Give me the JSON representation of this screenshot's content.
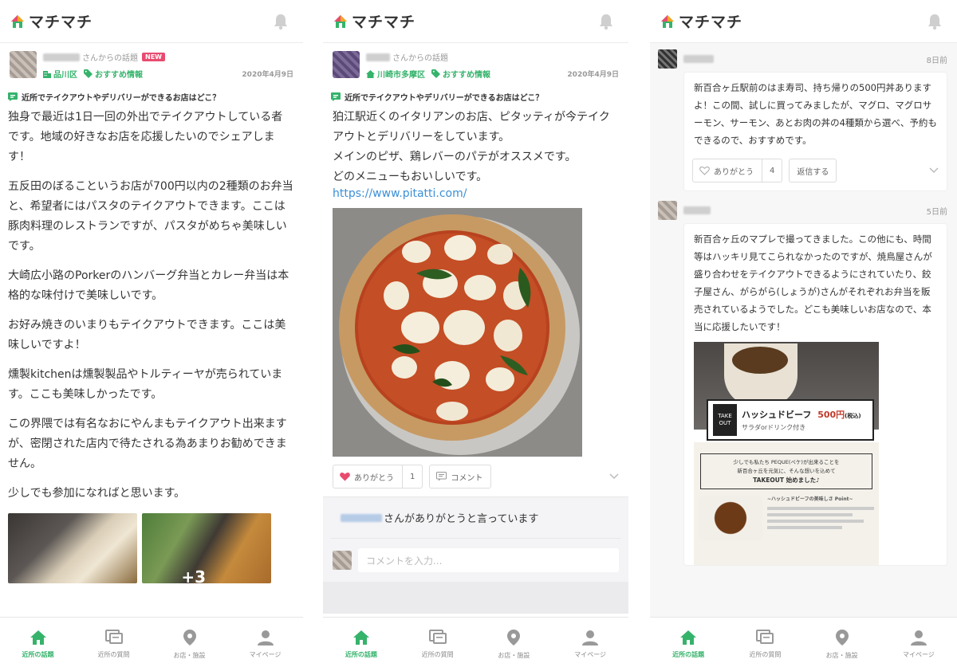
{
  "app": {
    "logo_text": "マチマチ",
    "accent": "#35b36b",
    "new_badge_color": "#e94b6f"
  },
  "tabs": [
    {
      "label": "近所の話題",
      "icon": "home-icon",
      "active": true
    },
    {
      "label": "近所の質問",
      "icon": "question-icon",
      "active": false
    },
    {
      "label": "お店・施設",
      "icon": "map-pin-icon",
      "active": false
    },
    {
      "label": "マイページ",
      "icon": "person-icon",
      "active": false
    }
  ],
  "screen1": {
    "from_suffix": "さんからの話題",
    "new_badge": "NEW",
    "area_tag": "品川区",
    "category_tag": "おすすめ情報",
    "date": "2020年4月9日",
    "topic": "近所でテイクアウトやデリバリーができるお店はどこ？",
    "paragraphs": [
      "独身で最近は1日一回の外出でテイクアウトしている者です。地域の好きなお店を応援したいのでシェアします！",
      "五反田のぼるこというお店が700円以内の2種類のお弁当と、希望者にはパスタのテイクアウトできます。ここは豚肉料理のレストランですが、パスタがめちゃ美味しいです。",
      "大崎広小路のPorkerのハンバーグ弁当とカレー弁当は本格的な味付けで美味しいです。",
      "お好み焼きのいまりもテイクアウトできます。ここは美味しいですよ！",
      "燻製kitchenは燻製製品やトルティーヤが売られています。ここも美味しかったです。",
      "この界隈では有名なおにやんまもテイクアウト出来ますが、密閉された店内で待たされる為あまりお勧めできません。",
      "少しでも参加になればと思います。"
    ],
    "more_photos": "+3"
  },
  "screen2": {
    "from_suffix": "さんからの話題",
    "area_tag": "川崎市多摩区",
    "category_tag": "おすすめ情報",
    "date": "2020年4月9日",
    "topic": "近所でテイクアウトやデリバリーができるお店はどこ？",
    "paragraphs": [
      "狛江駅近くのイタリアンのお店、ピタッティが今テイクアウトとデリバリーをしています。",
      "メインのピザ、鶏レバーのパテがオススメです。",
      "どのメニューもおいしいです。"
    ],
    "link": "https://www.pitatti.com/",
    "thanks_label": "ありがとう",
    "thanks_count": "1",
    "comment_label": "コメント",
    "thanks_message": "さんがありがとうと言っています",
    "comment_placeholder": "コメントを入力..."
  },
  "screen3": {
    "comment1": {
      "date": "8日前",
      "text": "新百合ヶ丘駅前のはま寿司、持ち帰りの500円丼ありますよ！この間、試しに買ってみましたが、マグロ、マグロサーモン、サーモン、あとお肉の丼の4種類から選べ、予約もできるので、おすすめです。",
      "thanks_label": "ありがとう",
      "thanks_count": "4",
      "reply_label": "返信する"
    },
    "comment2": {
      "date": "5日前",
      "text": "新百合ヶ丘のマプレで撮ってきました。この他にも、時間等はハッキリ見てこられなかったのですが、焼鳥屋さんが盛り合わせをテイクアウトできるようにされていたり、餃子屋さん、がらがら(しょうが)さんがそれぞれお弁当を販売されているようでした。どこも美味しいお店なので、本当に応援したいです！",
      "sign_title": "ハッシュドビーフ",
      "sign_price": "500円",
      "sign_tax": "(税込)",
      "sign_sub": "サラダorドリンク付き",
      "sign_takeout": "TAKE OUT",
      "poster_line1": "少しでも私たち PEQUE(ペケ)が出来ることを",
      "poster_line2": "新百合ヶ丘を元気に、そんな想いを込めて",
      "poster_line3": "TAKEOUT 始めました♪",
      "poster_line4": "~ハッシュドビーフの美味しさ Point~"
    }
  }
}
